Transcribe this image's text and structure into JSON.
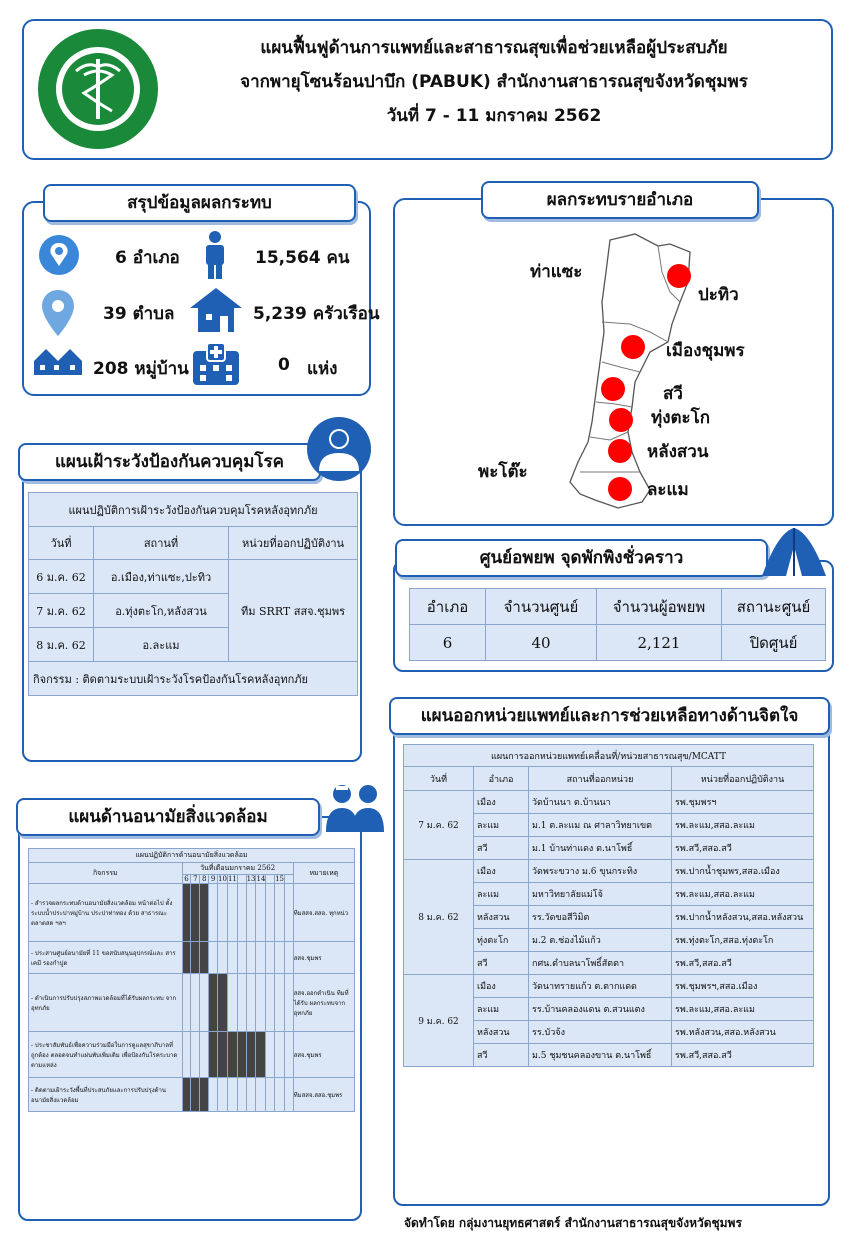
{
  "header": {
    "line1": "แผนฟื้นฟูด้านการแพทย์และสาธารณสุขเพื่อช่วยเหลือผู้ประสบภัย",
    "line2": "จากพายุโซนร้อนปาบึก (PABUK) สำนักงานสาธารณสุขจังหวัดชุมพร",
    "line3": "วันที่ 7 - 11 มกราคม 2562",
    "logo_text_top": "สาธารณสุขจังหวัดชุมพร",
    "logo_text_bottom": "Provincial of Public Health"
  },
  "summary": {
    "title": "สรุปข้อมูลผลกระทบ",
    "districts": "6 อำเภอ",
    "people": "15,564 คน",
    "subdistricts": "39 ตำบล",
    "households": "5,239 ครัวเรือน",
    "villages": "208 หมู่บ้าน",
    "facilities_count": "0",
    "facilities_unit": "แห่ง"
  },
  "district_impact": {
    "title": "ผลกระทบรายอำเภอ",
    "labels": [
      "ท่าแซะ",
      "ปะทิว",
      "เมืองชุมพร",
      "สวี",
      "ทุ่งตะโก",
      "หลังสวน",
      "พะโต๊ะ",
      "ละแม"
    ]
  },
  "surveillance": {
    "title": "แผนเฝ้าระวังป้องกันควบคุมโรค",
    "table_title": "แผนปฏิบัติการเฝ้าระวังป้องกันควบคุมโรคหลังอุทกภัย",
    "headers": [
      "วันที่",
      "สถานที่",
      "หน่วยที่ออกปฏิบัติงาน"
    ],
    "rows": [
      {
        "date": "6 ม.ค. 62",
        "place": "อ.เมือง,ท่าแซะ,ปะทิว"
      },
      {
        "date": "7 ม.ค. 62",
        "place": "อ.ทุ่งตะโก,หลังสวน"
      },
      {
        "date": "8 ม.ค. 62",
        "place": "อ.ละแม"
      }
    ],
    "unit": "ทีม SRRT สสจ.ชุมพร",
    "activity": "กิจกรรม : ติดตามระบบเฝ้าระวังโรคป้องกันโรคหลังอุทกภัย"
  },
  "shelter": {
    "title": "ศูนย์อพยพ จุดพักพิงชั่วคราว",
    "headers": [
      "อำเภอ",
      "จำนวนศูนย์",
      "จำนวนผู้อพยพ",
      "สถานะศูนย์"
    ],
    "values": [
      "6",
      "40",
      "2,121",
      "ปิดศูนย์"
    ]
  },
  "environment": {
    "title": "แผนด้านอนามัยสิ่งแวดล้อม",
    "table_title": "แผนปฏิบัติการด้านอนามัยสิ่งแวดล้อม",
    "col_activity": "กิจกรรม",
    "col_dates": "วันที่เดือนมกราคม 2562",
    "col_note": "หมายเหตุ",
    "days": [
      "6",
      "7",
      "8",
      "9",
      "10",
      "11",
      "",
      "13",
      "14",
      "",
      "15",
      ""
    ],
    "rows": [
      {
        "text": "- สำรวจผลกระทบด้านอนามัยสิ่งแวดล้อม หน้าต่อไป ตั้ง ระบบน้ำประปาหมู่บ้าน ประปาท่าทอง ด้วย สาธารณะ ตลาดสด ฯลฯ",
        "note": "ทีมสสจ.สสอ. ทุกหน่ว"
      },
      {
        "text": "- ประสานศูนย์อนามัยที่ 11 ขอสนับสนุนอุปกรณ์และ สารเคมี รองกำปูด",
        "note": "สสจ.ชุมพร"
      },
      {
        "text": "- ดำเนินการปรับปรุงสภาพแวดล้อมที่ได้รับผลกระทบ จากอุทกภัย",
        "note": "สสจ.ออกดำเนิน ทีมที่ได้รับ ผลกระทบจาก อุทกภัย"
      },
      {
        "text": "- ประชาสัมพันธ์เพื่อความร่วมมือในการดูแลสุขาภิบาลที่ถูกต้อง ตลอดจนทำแผ่นพับเพิ่มเติม เพื่อป้องกันโรคระบาดตามแหล่ง",
        "note": "สสจ.ชุมพร"
      },
      {
        "text": "- ติดตามเฝ้าระวังพื้นที่ประสบภัยและการปรับปรุงด้าน อนามัยสิ่งแวดล้อม",
        "note": "ทีมสสจ.สสอ.ชุมพร"
      }
    ]
  },
  "mcatt": {
    "title": "แผนออกหน่วยแพทย์และการช่วยเหลือทางด้านจิตใจ",
    "table_title": "แผนการออกหน่วยแพทย์เคลื่อนที่/หน่วยสาธารณสุข/MCATT",
    "headers": [
      "วันที่",
      "อำเภอ",
      "สถานที่ออกหน่วย",
      "หน่วยที่ออกปฏิบัติงาน"
    ],
    "groups": [
      {
        "date": "7 ม.ค. 62",
        "rows": [
          {
            "district": "เมือง",
            "place": "วัดบ้านนา ต.บ้านนา",
            "unit": "รพ.ชุมพรฯ"
          },
          {
            "district": "ละแม",
            "place": "ม.1 ต.ละแม ณ ศาลาวิทยาเขต",
            "unit": "รพ.ละแม,สสอ.ละแม"
          },
          {
            "district": "สวี",
            "place": "ม.1 บ้านท่าแดง ต.นาโพธิ์",
            "unit": "รพ.สวี,สสอ.สวี"
          }
        ]
      },
      {
        "date": "8 ม.ค. 62",
        "rows": [
          {
            "district": "เมือง",
            "place": "วัดพระขวาง ม.6 ขุนกระทิง",
            "unit": "รพ.ปากน้ำชุมพร,สสอ.เมือง"
          },
          {
            "district": "ละแม",
            "place": "มหาวิทยาลัยแม่โจ้",
            "unit": "รพ.ละแม,สสอ.ละแม"
          },
          {
            "district": "หลังสวน",
            "place": "รร.วัดขอสีวิมิต",
            "unit": "รพ.ปากน้ำหลังสวน,สสอ.หลังสวน"
          },
          {
            "district": "ทุ่งตะโก",
            "place": "ม.2 ต.ช่องไม้แก้ว",
            "unit": "รพ.ทุ่งตะโก,สสอ.ทุ่งตะโก"
          },
          {
            "district": "สวี",
            "place": "กศน.ตำบลนาโพธิ์สัตตา",
            "unit": "รพ.สวี,สสอ.สวี"
          }
        ]
      },
      {
        "date": "9 ม.ค. 62",
        "rows": [
          {
            "district": "เมือง",
            "place": "วัดนาทรายแก้ว ต.ตากแดด",
            "unit": "รพ.ชุมพรฯ,สสอ.เมือง"
          },
          {
            "district": "ละแม",
            "place": "รร.บ้านคลองแดน ต.สวนแตง",
            "unit": "รพ.ละแม,สสอ.ละแม"
          },
          {
            "district": "หลังสวน",
            "place": "รร.บัวจ้ง",
            "unit": "รพ.หลังสวน,สสอ.หลังสวน"
          },
          {
            "district": "สวี",
            "place": "ม.5 ชุมชนคลองขาน ต.นาโพธิ์",
            "unit": "รพ.สวี,สสอ.สวี"
          }
        ]
      }
    ]
  },
  "footer": "จัดทำโดย กลุ่มงานยุทธศาสตร์ สำนักงานสาธารณสุขจังหวัดชุมพร",
  "colors": {
    "primary": "#1f5fb4",
    "table_bg": "#dbe6f6",
    "dot": "#ff0000",
    "logo_green": "#1a8a3a"
  }
}
